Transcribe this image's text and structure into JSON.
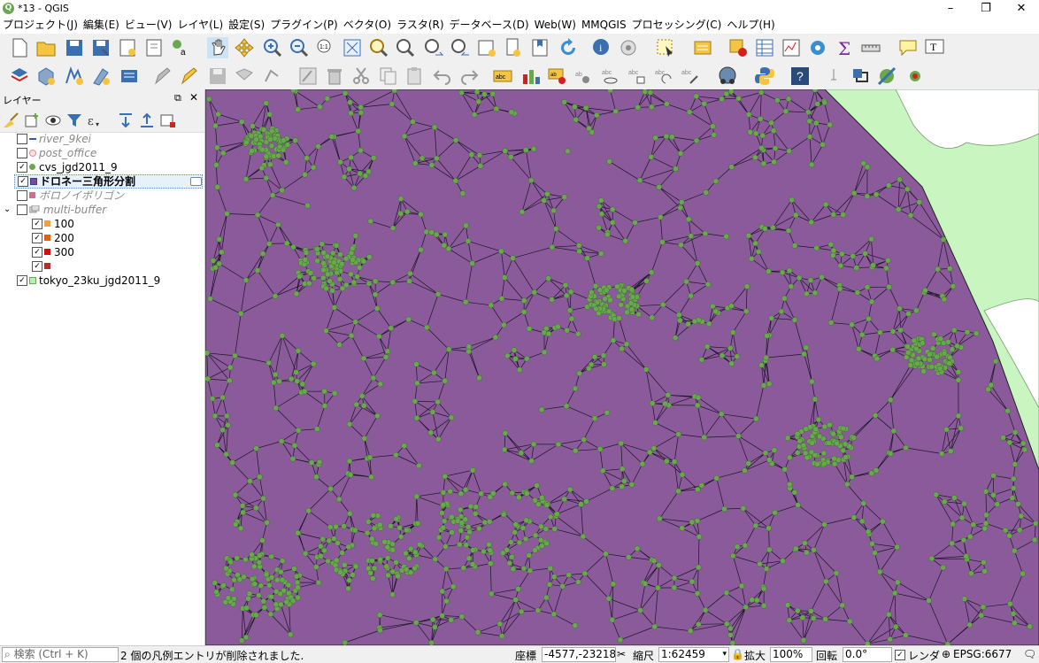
{
  "window": {
    "title": "*13 - QGIS",
    "app_icon": "qgis-logo"
  },
  "menu": [
    "プロジェクト(J)",
    "編集(E)",
    "ビュー(V)",
    "レイヤ(L)",
    "設定(S)",
    "プラグイン(P)",
    "ベクタ(O)",
    "ラスタ(R)",
    "データベース(D)",
    "Web(W)",
    "MMQGIS",
    "プロセッシング(C)",
    "ヘルプ(H)"
  ],
  "layers_panel": {
    "title": "レイヤー",
    "layers": [
      {
        "name": "river_9kei",
        "checked": false,
        "style": "gray-italic",
        "symbol_color": "#3c5a9a"
      },
      {
        "name": "post_office",
        "checked": false,
        "style": "gray-italic",
        "symbol_color": "#e88c8c"
      },
      {
        "name": "cvs_jgd2011_9",
        "checked": true,
        "style": "normal",
        "symbol_color": "#6aa84f"
      },
      {
        "name": "ドロネー三角形分割",
        "checked": true,
        "style": "bold-selected",
        "symbol_color": "#7b4a9b"
      },
      {
        "name": "ボロノイポリゴン",
        "checked": false,
        "style": "gray-italic",
        "symbol_color": "#d96a8a"
      },
      {
        "name": "multi-buffer",
        "checked": false,
        "style": "gray-italic-group",
        "symbol_color": "#999999"
      },
      {
        "name": "100",
        "checked": true,
        "style": "child",
        "symbol_color": "#f0a040"
      },
      {
        "name": "200",
        "checked": true,
        "style": "child",
        "symbol_color": "#e06010"
      },
      {
        "name": "300",
        "checked": true,
        "style": "child",
        "symbol_color": "#d01010"
      },
      {
        "name": "",
        "checked": true,
        "style": "child",
        "symbol_color": "#b03030"
      },
      {
        "name": "tokyo_23ku_jgd2011_9",
        "checked": true,
        "style": "normal",
        "symbol_color": "#b8f0b0"
      }
    ]
  },
  "map": {
    "fill_color": "#8a5a9a",
    "point_color": "#6aa84f",
    "land_color": "#c8f5c0"
  },
  "status": {
    "search_placeholder": "検索 (Ctrl + K)",
    "message": "2 個の凡例エントリが削除されました.",
    "coord_label": "座標",
    "coord_value": "-4577,-23218",
    "scale_label": "縮尺",
    "scale_value": "1:62459",
    "magnify_label": "拡大",
    "magnify_value": "100%",
    "rotation_label": "回転",
    "rotation_value": "0.0°",
    "render_label": "レンダ",
    "crs": "EPSG:6677"
  }
}
